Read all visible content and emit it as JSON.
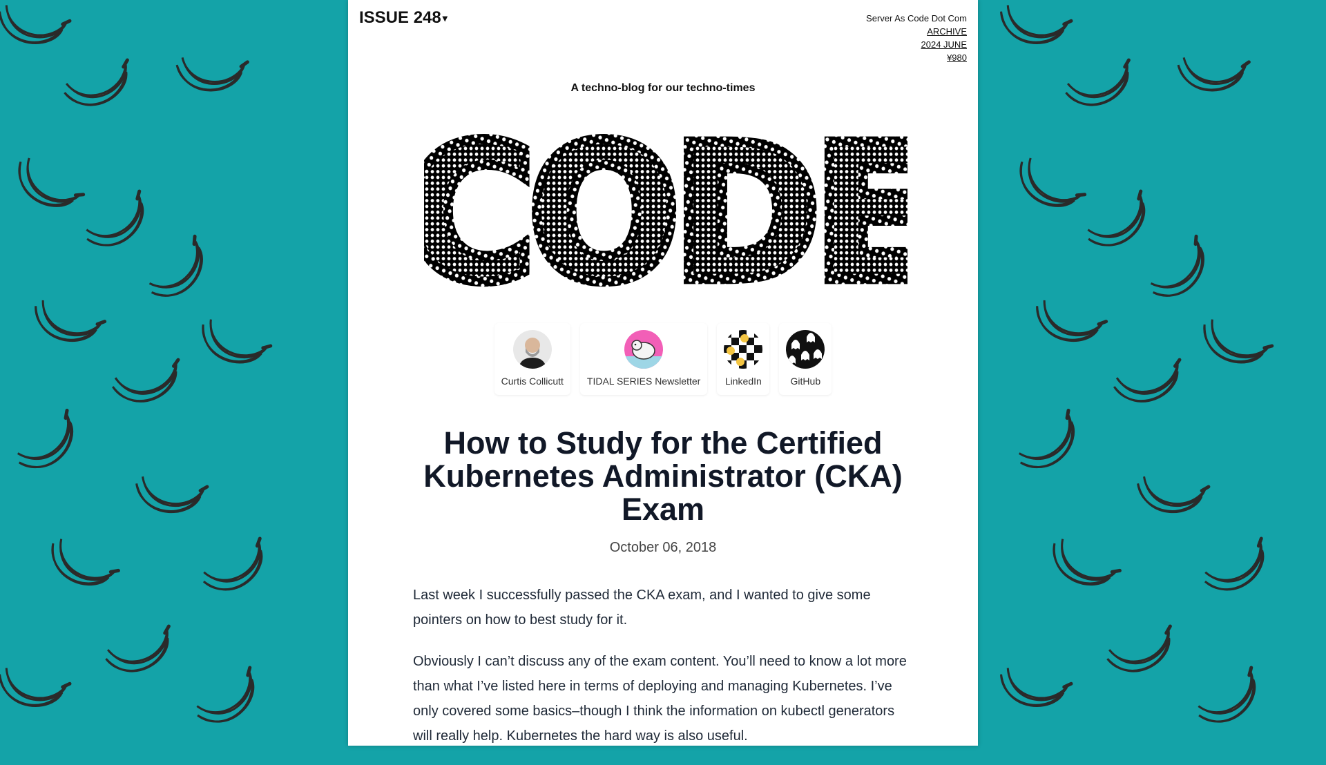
{
  "header": {
    "issue_label": "ISSUE 248",
    "site_name": "Server As Code Dot Com",
    "archive_link": "ARCHIVE",
    "date_link": "2024 JUNE",
    "price_link": "¥980"
  },
  "tagline": "A techno-blog for our techno-times",
  "logo_text": "CODE",
  "social_links": [
    {
      "label": "Curtis Collicutt",
      "icon": "author-avatar"
    },
    {
      "label": "TIDAL SERIES Newsletter",
      "icon": "polar-bear-avatar"
    },
    {
      "label": "LinkedIn",
      "icon": "checker-smiley-icon"
    },
    {
      "label": "GitHub",
      "icon": "ghost-pattern-icon"
    }
  ],
  "article": {
    "title": "How to Study for the Certified Kubernetes Administrator (CKA) Exam",
    "date": "October 06, 2018",
    "paragraphs": [
      "Last week I successfully passed the CKA exam, and I wanted to give some pointers on how to best study for it.",
      "Obviously I can’t discuss any of the exam content. You’ll need to know a lot more than what I’ve listed here in terms of deploying and managing Kubernetes. I’ve only covered some basics–though I think the information on kubectl generators will really help. Kubernetes the hard way is also useful."
    ]
  },
  "colors": {
    "background": "#14a3a8",
    "banana": "#f7c24a",
    "page": "#ffffff",
    "accent_pink": "#f25fb7"
  }
}
